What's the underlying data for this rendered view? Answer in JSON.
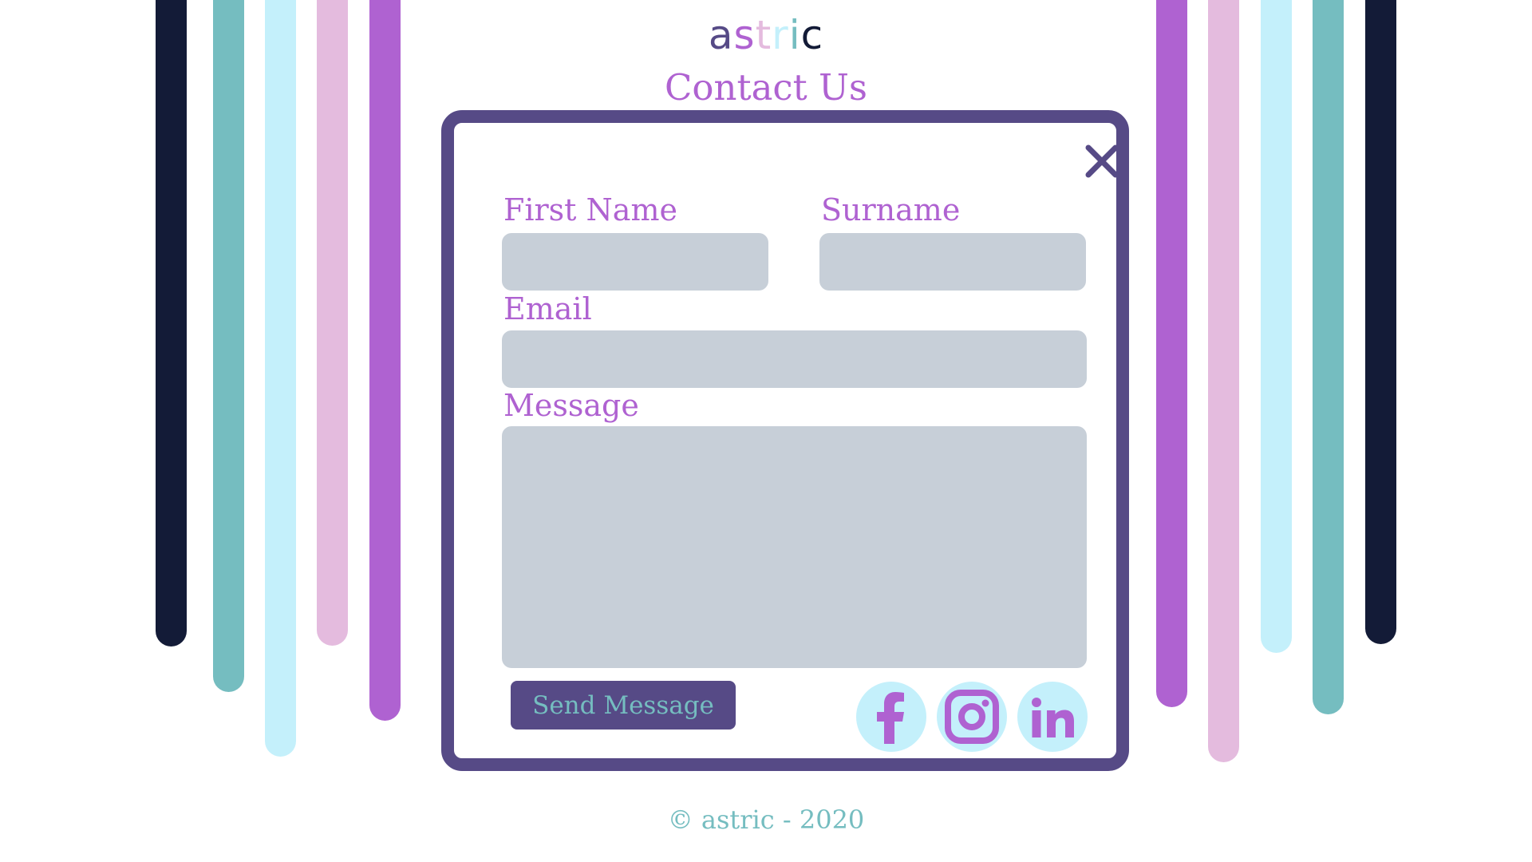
{
  "colors": {
    "navy": "#131b37",
    "teal": "#75bdc0",
    "light_cyan": "#c4f0fb",
    "pink": "#e4bbde",
    "purple": "#af62d1",
    "deep_purple": "#564a86",
    "field_gray": "#c7cfd8"
  },
  "brand": {
    "letters": [
      {
        "char": "a",
        "color": "#564a86"
      },
      {
        "char": "s",
        "color": "#af62d1"
      },
      {
        "char": "t",
        "color": "#e4bbde"
      },
      {
        "char": "r",
        "color": "#c4f0fb"
      },
      {
        "char": "i",
        "color": "#75bdc0"
      },
      {
        "char": "c",
        "color": "#131b37"
      }
    ]
  },
  "page": {
    "title": "Contact Us"
  },
  "form": {
    "close_icon": "close-icon",
    "first_name_label": "First Name",
    "first_name_value": "",
    "surname_label": "Surname",
    "surname_value": "",
    "email_label": "Email",
    "email_value": "",
    "message_label": "Message",
    "message_value": "",
    "submit_label": "Send Message"
  },
  "social": [
    {
      "name": "facebook",
      "icon": "facebook-icon"
    },
    {
      "name": "instagram",
      "icon": "instagram-icon"
    },
    {
      "name": "linkedin",
      "icon": "linkedin-icon"
    }
  ],
  "footer": {
    "text": "© astric - 2020"
  }
}
